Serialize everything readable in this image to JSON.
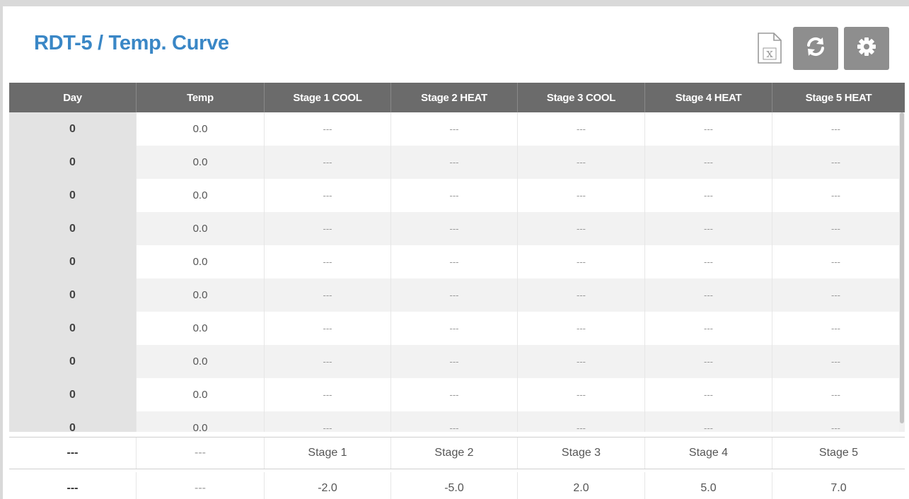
{
  "title": "RDT-5 / Temp. Curve",
  "toolbar": {
    "excel_icon": "excel-export-icon",
    "refresh_icon": "refresh-icon",
    "settings_icon": "gear-icon"
  },
  "colors": {
    "title": "#3a87c6",
    "header_bg": "#6b6b6b",
    "button_bg": "#8e8e8e"
  },
  "table": {
    "columns": [
      "Day",
      "Temp",
      "Stage 1 COOL",
      "Stage 2 HEAT",
      "Stage 3 COOL",
      "Stage 4 HEAT",
      "Stage 5 HEAT"
    ],
    "rows": [
      [
        "0",
        "0.0",
        "---",
        "---",
        "---",
        "---",
        "---"
      ],
      [
        "0",
        "0.0",
        "---",
        "---",
        "---",
        "---",
        "---"
      ],
      [
        "0",
        "0.0",
        "---",
        "---",
        "---",
        "---",
        "---"
      ],
      [
        "0",
        "0.0",
        "---",
        "---",
        "---",
        "---",
        "---"
      ],
      [
        "0",
        "0.0",
        "---",
        "---",
        "---",
        "---",
        "---"
      ],
      [
        "0",
        "0.0",
        "---",
        "---",
        "---",
        "---",
        "---"
      ],
      [
        "0",
        "0.0",
        "---",
        "---",
        "---",
        "---",
        "---"
      ],
      [
        "0",
        "0.0",
        "---",
        "---",
        "---",
        "---",
        "---"
      ],
      [
        "0",
        "0.0",
        "---",
        "---",
        "---",
        "---",
        "---"
      ],
      [
        "0",
        "0.0",
        "---",
        "---",
        "---",
        "---",
        "---"
      ]
    ],
    "footer_rows": [
      [
        "---",
        "---",
        "Stage 1",
        "Stage 2",
        "Stage 3",
        "Stage 4",
        "Stage 5"
      ],
      [
        "---",
        "---",
        "-2.0",
        "-5.0",
        "2.0",
        "5.0",
        "7.0"
      ]
    ]
  }
}
